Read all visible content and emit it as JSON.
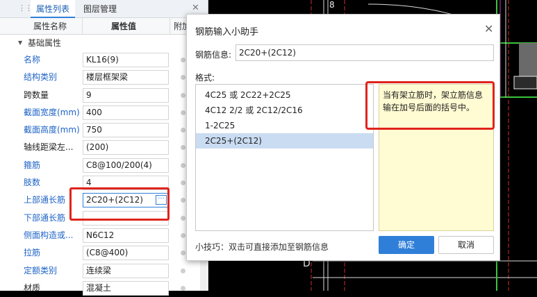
{
  "panel": {
    "tabs": [
      "属性列表",
      "图层管理"
    ],
    "columns": [
      "属性名称",
      "属性值",
      "附加"
    ],
    "group_label": "基础属性",
    "rows": [
      {
        "name": "名称",
        "value": "KL16(9)",
        "color": "blue"
      },
      {
        "name": "结构类别",
        "value": "楼层框架梁",
        "color": "blue"
      },
      {
        "name": "跨数量",
        "value": "9",
        "color": "black"
      },
      {
        "name": "截面宽度(mm)",
        "value": "400",
        "color": "blue"
      },
      {
        "name": "截面高度(mm)",
        "value": "750",
        "color": "blue"
      },
      {
        "name": "轴线距梁左...",
        "value": "(200)",
        "color": "black"
      },
      {
        "name": "箍筋",
        "value": "C8@100/200(4)",
        "color": "blue"
      },
      {
        "name": "肢数",
        "value": "4",
        "color": "blue"
      },
      {
        "name": "上部通长筋",
        "value": "2C20+(2C12)",
        "color": "blue"
      },
      {
        "name": "下部通长筋",
        "value": "",
        "color": "blue"
      },
      {
        "name": "侧面构造或...",
        "value": "N6C12",
        "color": "blue"
      },
      {
        "name": "拉筋",
        "value": "(C8@400)",
        "color": "blue"
      },
      {
        "name": "定额类别",
        "value": "连续梁",
        "color": "blue"
      },
      {
        "name": "材质",
        "value": "混凝土",
        "color": "black"
      }
    ]
  },
  "dialog": {
    "title": "钢筋输入小助手",
    "info_label": "钢筋信息:",
    "info_value": "2C20+(2C12)",
    "format_label": "格式:",
    "formats": [
      "4C25 或 2C22+2C25",
      "4C12 2/2 或 2C12/2C16",
      "1-2C25",
      "2C25+(2C12)"
    ],
    "hint": "当有架立筋时，架立筋信息输在加号后面的括号中。",
    "tip": "小技巧：双击可直接添加至钢筋信息",
    "ok_label": "确定",
    "cancel_label": "取消"
  },
  "cad": {
    "labels": [
      "D",
      "8"
    ]
  },
  "colors": {
    "accent": "#2f7fd9",
    "highlight_red": "#e0231b",
    "hint_bg": "#fffbd2",
    "link_blue": "#1e63c6"
  }
}
